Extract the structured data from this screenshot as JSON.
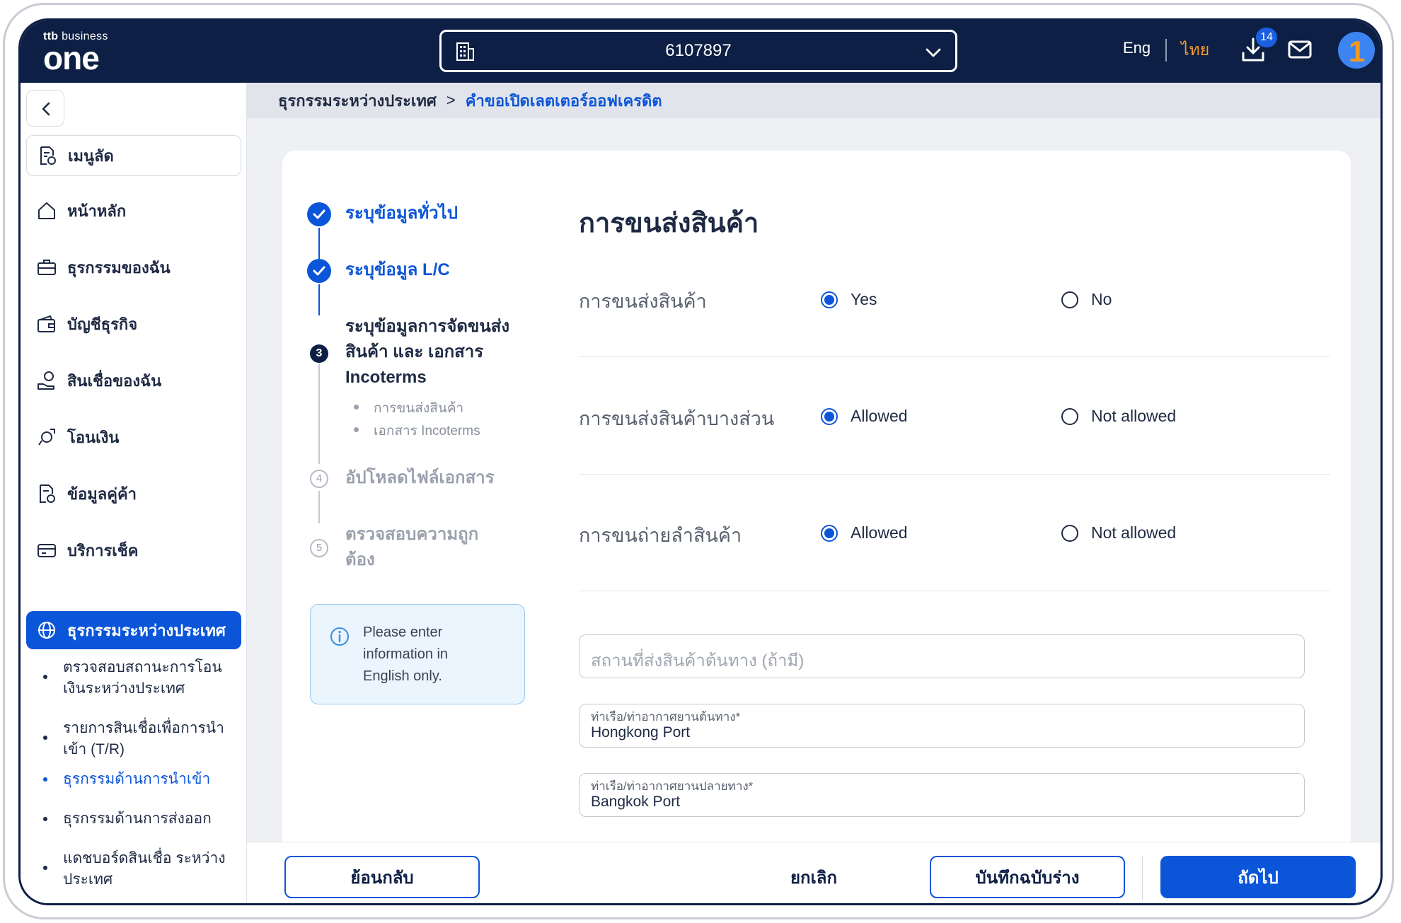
{
  "header": {
    "logo_top": "business",
    "logo_ttb": "ttb",
    "logo_main": "one",
    "account_number": "6107897",
    "lang_en": "Eng",
    "lang_th": "ไทย",
    "download_badge": "14"
  },
  "sidebar": {
    "shortcut_label": "เมนูลัด",
    "items": [
      {
        "label": "หน้าหลัก",
        "icon": "home-icon"
      },
      {
        "label": "ธุรกรรมของฉัน",
        "icon": "briefcase-icon"
      },
      {
        "label": "บัญชีธุรกิจ",
        "icon": "wallet-icon"
      },
      {
        "label": "สินเชื่อของฉัน",
        "icon": "loan-icon"
      },
      {
        "label": "โอนเงิน",
        "icon": "transfer-icon"
      },
      {
        "label": "ข้อมูลคู่ค้า",
        "icon": "partner-icon"
      },
      {
        "label": "บริการเช็ค",
        "icon": "cheque-icon"
      },
      {
        "label": "ธุรกรรมระหว่างประเทศ",
        "icon": "globe-icon"
      }
    ],
    "sub_items": [
      {
        "line1": "ตรวจสอบสถานะการโอน",
        "line2": "เงินระหว่างประเทศ"
      },
      {
        "line1": "รายการสินเชื่อเพื่อการนำ",
        "line2": "เข้า (T/R)"
      },
      {
        "line1": "ธุรกรรมด้านการนำเข้า",
        "line2": ""
      },
      {
        "line1": "ธุรกรรมด้านการส่งออก",
        "line2": ""
      },
      {
        "line1": "แดชบอร์ดสินเชื่อ ระหว่าง",
        "line2": "ประเทศ"
      }
    ]
  },
  "breadcrumb": {
    "root": "ธุรกรรมระหว่างประเทศ",
    "current": "คำขอเปิดเลตเตอร์ออฟเครดิต"
  },
  "stepper": {
    "step1": "ระบุข้อมูลทั่วไป",
    "step2": "ระบุข้อมูล L/C",
    "step3_line1": "ระบุข้อมูลการจัดขนส่ง",
    "step3_line2": "สินค้า และ เอกสาร",
    "step3_line3": "Incoterms",
    "step3_num": "3",
    "step3_sub1": "การขนส่งสินค้า",
    "step3_sub2": "เอกสาร Incoterms",
    "step4": "อัปโหลดไฟล์เอกสาร",
    "step4_num": "4",
    "step5_line1": "ตรวจสอบความถูก",
    "step5_line2": "ต้อง",
    "step5_num": "5"
  },
  "info_box": {
    "line1": "Please enter",
    "line2": "information in",
    "line3": "English only."
  },
  "form": {
    "title": "การขนส่งสินค้า",
    "rows": [
      {
        "label": "การขนส่งสินค้า",
        "opt1": "Yes",
        "opt2": "No"
      },
      {
        "label": "การขนส่งสินค้าบางส่วน",
        "opt1": "Allowed",
        "opt2": "Not allowed"
      },
      {
        "label": "การขนถ่ายลำสินค้า",
        "opt1": "Allowed",
        "opt2": "Not allowed"
      }
    ],
    "origin_place_placeholder": "สถานที่ส่งสินค้าต้นทาง (ถ้ามี)",
    "origin_port_label": "ท่าเรือ/ท่าอากาศยานต้นทาง*",
    "origin_port_value": "Hongkong Port",
    "dest_port_label": "ท่าเรือ/ท่าอากาศยานปลายทาง*",
    "dest_port_value": "Bangkok Port"
  },
  "footer": {
    "back": "ย้อนกลับ",
    "cancel": "ยกเลิก",
    "save_draft": "บันทึกฉบับร่าง",
    "next": "ถัดไป"
  },
  "colors": {
    "navy": "#0d1f44",
    "primary": "#0b55d9",
    "accent_orange": "#f39a2c"
  }
}
